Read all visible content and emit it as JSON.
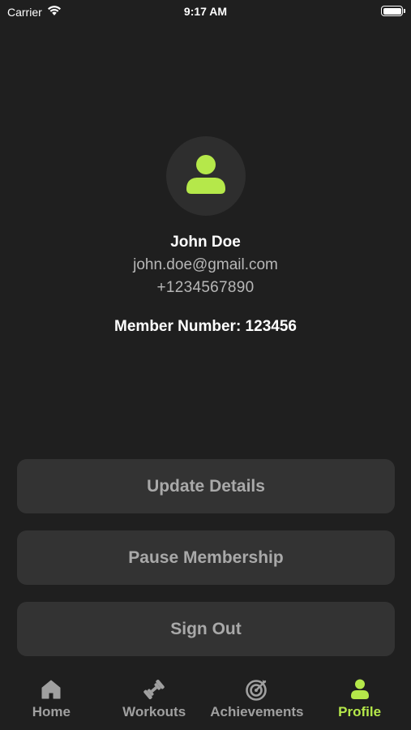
{
  "status_bar": {
    "carrier": "Carrier",
    "time": "9:17 AM"
  },
  "profile": {
    "name": "John Doe",
    "email": "john.doe@gmail.com",
    "phone": "+1234567890",
    "member_number": "Member Number: 123456",
    "avatar_icon": "person-icon"
  },
  "actions": {
    "update_details": "Update Details",
    "pause_membership": "Pause Membership",
    "sign_out": "Sign Out"
  },
  "tabs": [
    {
      "label": "Home",
      "icon": "home-icon",
      "active": false
    },
    {
      "label": "Workouts",
      "icon": "dumbbell-icon",
      "active": false
    },
    {
      "label": "Achievements",
      "icon": "target-icon",
      "active": false
    },
    {
      "label": "Profile",
      "icon": "person-icon",
      "active": true
    }
  ],
  "colors": {
    "background": "#1f1f1f",
    "accent": "#b5e84a",
    "button_bg": "#333333",
    "button_text": "#a9a9a9",
    "muted_text": "#b7b7b7"
  }
}
